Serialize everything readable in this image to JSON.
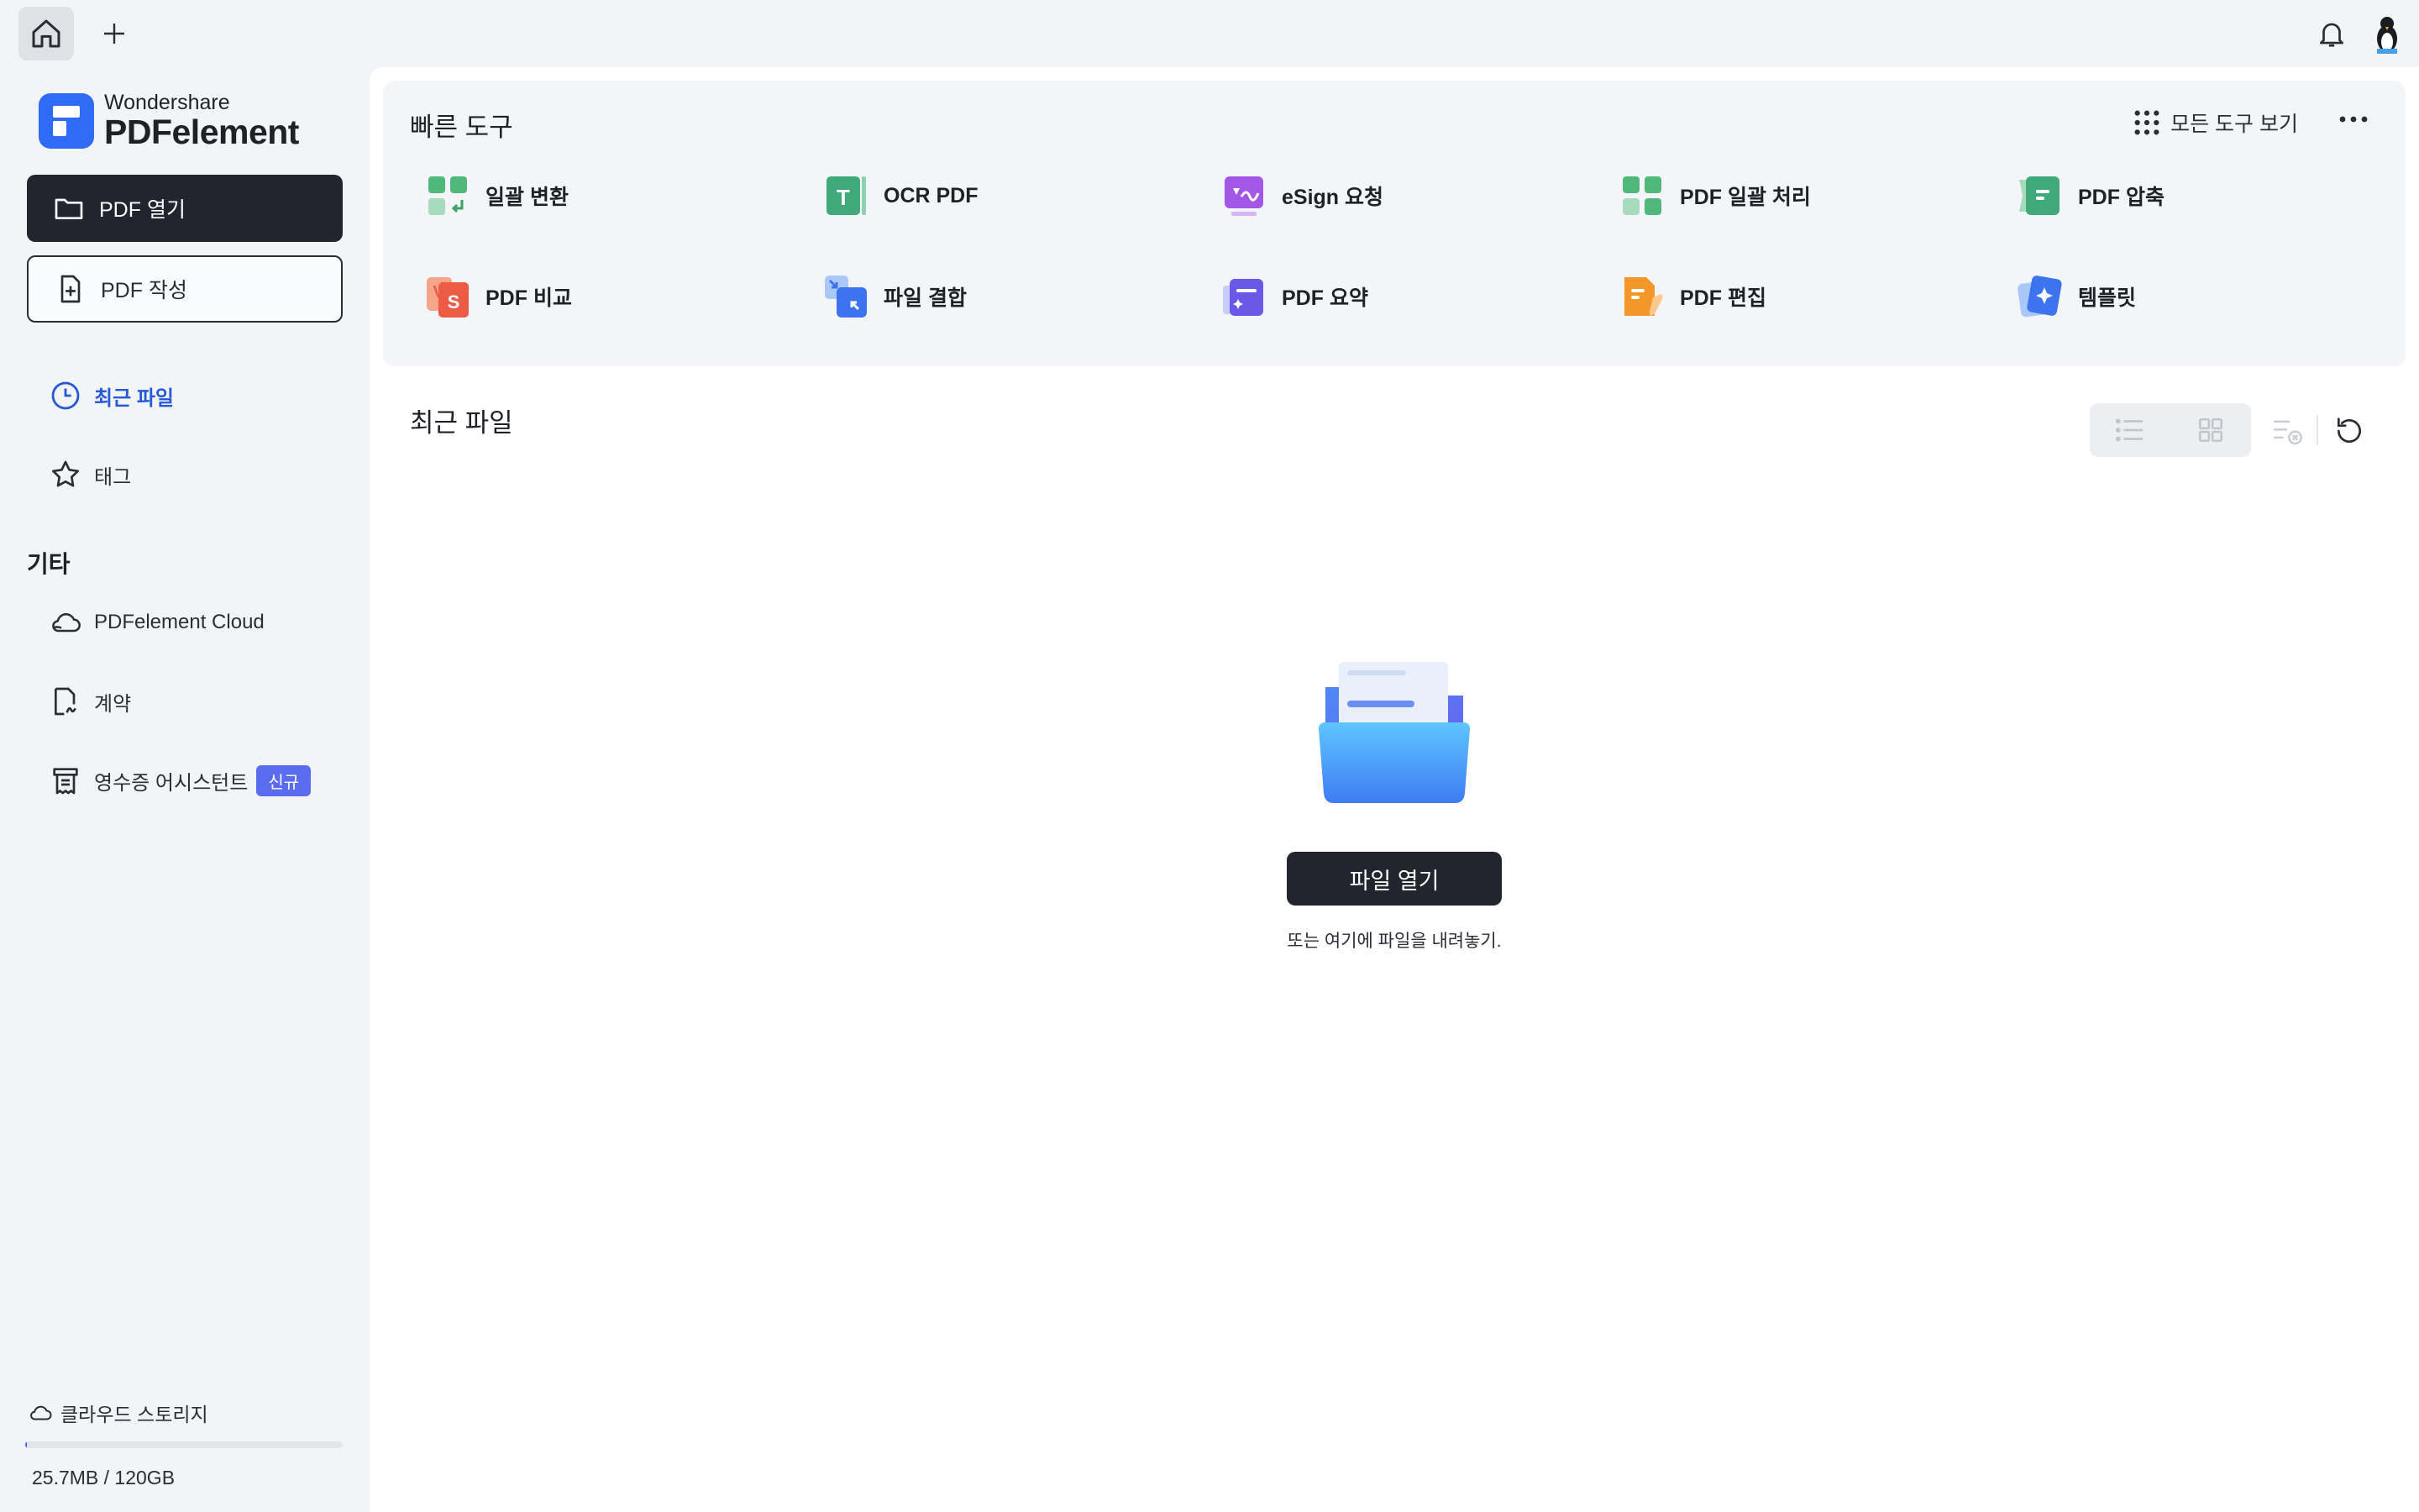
{
  "topbar": {
    "home_icon": "home-icon",
    "add_icon": "plus-icon",
    "bell_icon": "bell-icon",
    "avatar_icon": "avatar-icon"
  },
  "sidebar": {
    "logo_brand": "Wondershare",
    "logo_product": "PDFelement",
    "open_pdf": "PDF 열기",
    "create_pdf": "PDF 작성",
    "nav": [
      {
        "label": "최근 파일",
        "icon": "clock-icon",
        "active": true
      },
      {
        "label": "태그",
        "icon": "star-icon",
        "active": false
      }
    ],
    "other_title": "기타",
    "other": [
      {
        "label": "PDFelement Cloud",
        "icon": "cloud-icon"
      },
      {
        "label": "계약",
        "icon": "contract-icon"
      },
      {
        "label": "영수증 어시스턴트",
        "icon": "receipt-icon",
        "badge": "신규"
      }
    ],
    "storage": {
      "label": "클라우드 스토리지",
      "value": "25.7MB / 120GB",
      "used_fraction": 0.0002
    }
  },
  "quick_tools": {
    "title": "빠른 도구",
    "all_tools_label": "모든 도구 보기",
    "items": [
      {
        "label": "일괄 변환",
        "icon": "batch-convert-icon"
      },
      {
        "label": "OCR PDF",
        "icon": "ocr-icon"
      },
      {
        "label": "eSign 요청",
        "icon": "esign-icon"
      },
      {
        "label": "PDF 일괄 처리",
        "icon": "batch-process-icon"
      },
      {
        "label": "PDF 압축",
        "icon": "compress-icon"
      },
      {
        "label": "PDF 비교",
        "icon": "compare-icon"
      },
      {
        "label": "파일 결합",
        "icon": "combine-icon"
      },
      {
        "label": "PDF 요약",
        "icon": "summarize-icon"
      },
      {
        "label": "PDF 편집",
        "icon": "edit-icon"
      },
      {
        "label": "템플릿",
        "icon": "template-icon"
      }
    ]
  },
  "recent": {
    "title": "최근 파일",
    "open_file_button": "파일 열기",
    "drop_hint": "또는 여기에 파일을 내려놓기."
  },
  "colors": {
    "accent": "#2f6bf5",
    "dark_button": "#22252e",
    "active_nav": "#2559d6",
    "badge": "#5a6cf0"
  }
}
